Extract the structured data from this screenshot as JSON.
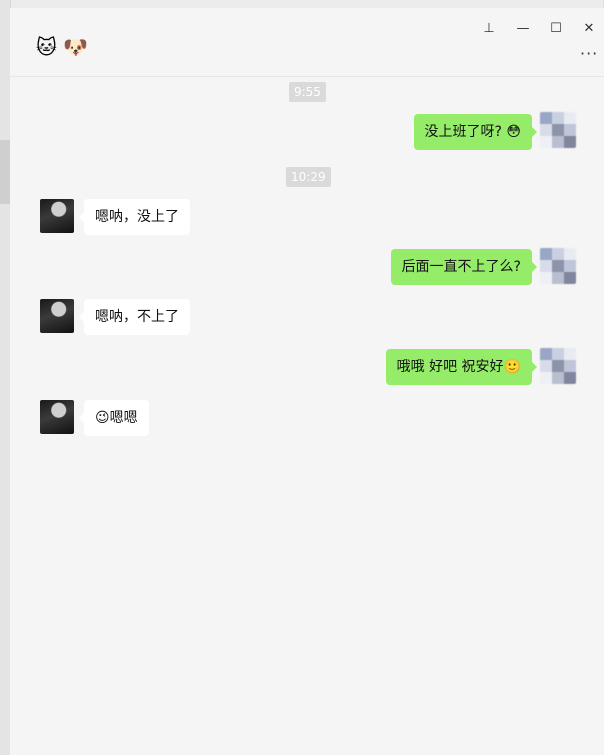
{
  "window": {
    "title": "🐱 🐶",
    "controls": {
      "pin": "⊥",
      "minimize": "—",
      "maximize": "☐",
      "close": "✕"
    },
    "more_label": "···"
  },
  "messages": [
    {
      "type": "time",
      "text": "9:55"
    },
    {
      "type": "message",
      "side": "right",
      "text": "没上班了呀? 😳"
    },
    {
      "type": "time",
      "text": "10:29"
    },
    {
      "type": "message",
      "side": "left",
      "text": "嗯呐，没上了"
    },
    {
      "type": "message",
      "side": "right",
      "text": "后面一直不上了么?"
    },
    {
      "type": "message",
      "side": "left",
      "text": "嗯呐，不上了"
    },
    {
      "type": "message",
      "side": "right",
      "text": "哦哦 好吧 祝安好🙂"
    },
    {
      "type": "message",
      "side": "left",
      "text": "😉嗯嗯"
    }
  ],
  "colors": {
    "self_bubble": "#95ec69",
    "other_bubble": "#ffffff",
    "background": "#f5f5f5",
    "time_badge": "#dadada"
  }
}
